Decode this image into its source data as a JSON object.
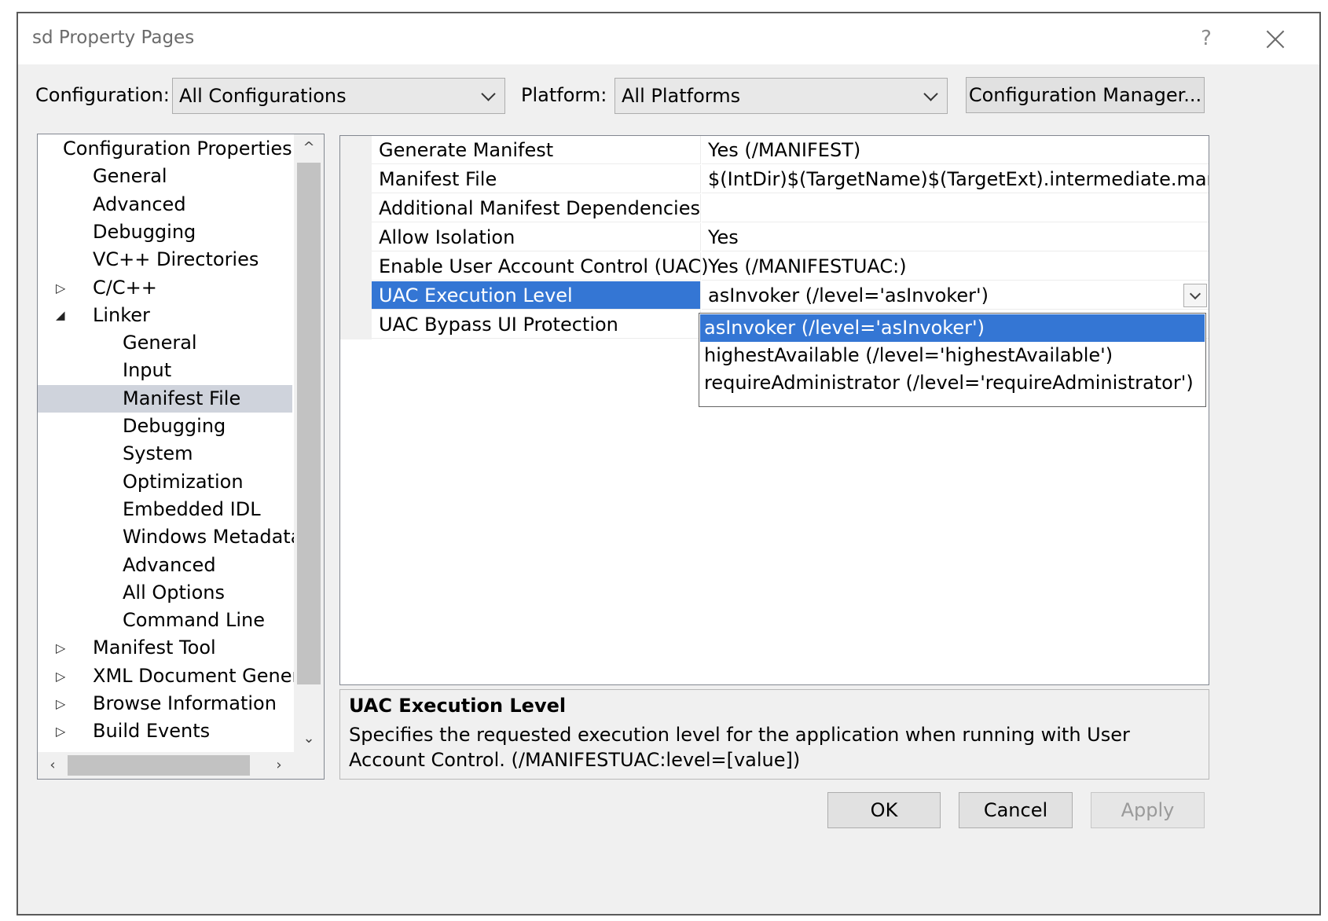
{
  "window": {
    "title": "sd Property Pages",
    "help_label": "?"
  },
  "config_bar": {
    "configuration_label": "Configuration:",
    "configuration_value": "All Configurations",
    "platform_label": "Platform:",
    "platform_value": "All Platforms",
    "config_manager_label": "Configuration Manager..."
  },
  "tree": {
    "items": [
      {
        "label": "Configuration Properties",
        "expander": "expanded"
      },
      {
        "label": "General"
      },
      {
        "label": "Advanced"
      },
      {
        "label": "Debugging"
      },
      {
        "label": "VC++ Directories"
      },
      {
        "label": "C/C++",
        "expander": "collapsed"
      },
      {
        "label": "Linker",
        "expander": "expanded"
      },
      {
        "label": "General"
      },
      {
        "label": "Input"
      },
      {
        "label": "Manifest File",
        "selected": true
      },
      {
        "label": "Debugging"
      },
      {
        "label": "System"
      },
      {
        "label": "Optimization"
      },
      {
        "label": "Embedded IDL"
      },
      {
        "label": "Windows Metadata"
      },
      {
        "label": "Advanced"
      },
      {
        "label": "All Options"
      },
      {
        "label": "Command Line"
      },
      {
        "label": "Manifest Tool",
        "expander": "collapsed"
      },
      {
        "label": "XML Document Genera",
        "expander": "collapsed"
      },
      {
        "label": "Browse Information",
        "expander": "collapsed"
      },
      {
        "label": "Build Events",
        "expander": "collapsed"
      }
    ]
  },
  "properties": [
    {
      "name": "Generate Manifest",
      "value": "Yes (/MANIFEST)"
    },
    {
      "name": "Manifest File",
      "value": "$(IntDir)$(TargetName)$(TargetExt).intermediate.manifest"
    },
    {
      "name": "Additional Manifest Dependencies",
      "value": ""
    },
    {
      "name": "Allow Isolation",
      "value": "Yes"
    },
    {
      "name": "Enable User Account Control (UAC)",
      "value": "Yes (/MANIFESTUAC:)"
    },
    {
      "name": "UAC Execution Level",
      "value": "asInvoker (/level='asInvoker')",
      "selected": true
    },
    {
      "name": "UAC Bypass UI Protection",
      "value": ""
    }
  ],
  "dropdown": {
    "options": [
      "asInvoker (/level='asInvoker')",
      "highestAvailable (/level='highestAvailable')",
      "requireAdministrator (/level='requireAdministrator')"
    ],
    "selected_index": 0
  },
  "description": {
    "title": "UAC Execution Level",
    "text": "Specifies the requested execution level for the application when running with User Account Control. (/MANIFESTUAC:level=[value])"
  },
  "buttons": {
    "ok": "OK",
    "cancel": "Cancel",
    "apply": "Apply"
  },
  "colors": {
    "selection": "#3476d4",
    "tree_selection": "#cfd3dc"
  }
}
